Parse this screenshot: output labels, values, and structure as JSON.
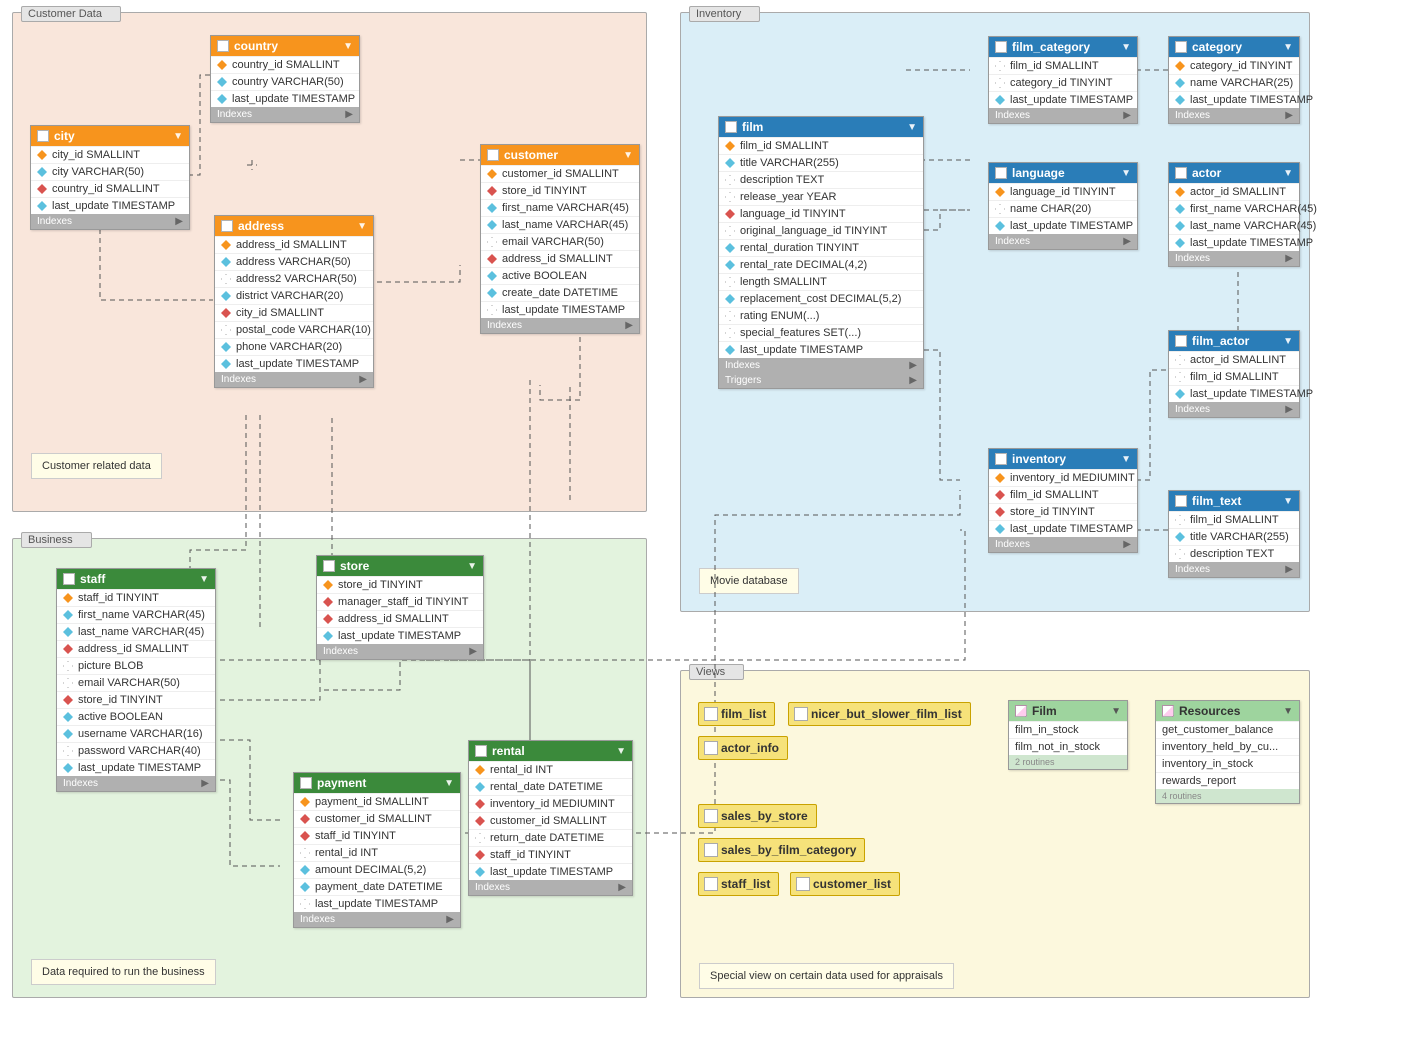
{
  "regions": {
    "customer": {
      "label": "Customer Data",
      "note": "Customer related data"
    },
    "business": {
      "label": "Business",
      "note": "Data required to run the business"
    },
    "inventory": {
      "label": "Inventory",
      "note": "Movie database"
    },
    "views": {
      "label": "Views",
      "note": "Special view on certain data used for appraisals"
    }
  },
  "footers": {
    "indexes": "Indexes",
    "triggers": "Triggers"
  },
  "routines_footer": {
    "film": "2 routines",
    "resources": "4 routines"
  },
  "tables": {
    "country": {
      "name": "country",
      "cols": [
        {
          "t": "pk",
          "n": "country_id SMALLINT"
        },
        {
          "t": "idx",
          "n": "country VARCHAR(50)"
        },
        {
          "t": "idx",
          "n": "last_update TIMESTAMP"
        }
      ]
    },
    "city": {
      "name": "city",
      "cols": [
        {
          "t": "pk",
          "n": "city_id SMALLINT"
        },
        {
          "t": "idx",
          "n": "city VARCHAR(50)"
        },
        {
          "t": "fk",
          "n": "country_id SMALLINT"
        },
        {
          "t": "idx",
          "n": "last_update TIMESTAMP"
        }
      ]
    },
    "address": {
      "name": "address",
      "cols": [
        {
          "t": "pk",
          "n": "address_id SMALLINT"
        },
        {
          "t": "idx",
          "n": "address VARCHAR(50)"
        },
        {
          "t": "att",
          "n": "address2 VARCHAR(50)"
        },
        {
          "t": "idx",
          "n": "district VARCHAR(20)"
        },
        {
          "t": "fk",
          "n": "city_id SMALLINT"
        },
        {
          "t": "att",
          "n": "postal_code VARCHAR(10)"
        },
        {
          "t": "idx",
          "n": "phone VARCHAR(20)"
        },
        {
          "t": "idx",
          "n": "last_update TIMESTAMP"
        }
      ]
    },
    "customer": {
      "name": "customer",
      "cols": [
        {
          "t": "pk",
          "n": "customer_id SMALLINT"
        },
        {
          "t": "fk",
          "n": "store_id TINYINT"
        },
        {
          "t": "idx",
          "n": "first_name VARCHAR(45)"
        },
        {
          "t": "idx",
          "n": "last_name VARCHAR(45)"
        },
        {
          "t": "att",
          "n": "email VARCHAR(50)"
        },
        {
          "t": "fk",
          "n": "address_id SMALLINT"
        },
        {
          "t": "idx",
          "n": "active BOOLEAN"
        },
        {
          "t": "idx",
          "n": "create_date DATETIME"
        },
        {
          "t": "att",
          "n": "last_update TIMESTAMP"
        }
      ]
    },
    "staff": {
      "name": "staff",
      "cols": [
        {
          "t": "pk",
          "n": "staff_id TINYINT"
        },
        {
          "t": "idx",
          "n": "first_name VARCHAR(45)"
        },
        {
          "t": "idx",
          "n": "last_name VARCHAR(45)"
        },
        {
          "t": "fk",
          "n": "address_id SMALLINT"
        },
        {
          "t": "att",
          "n": "picture BLOB"
        },
        {
          "t": "att",
          "n": "email VARCHAR(50)"
        },
        {
          "t": "fk",
          "n": "store_id TINYINT"
        },
        {
          "t": "idx",
          "n": "active BOOLEAN"
        },
        {
          "t": "idx",
          "n": "username VARCHAR(16)"
        },
        {
          "t": "att",
          "n": "password VARCHAR(40)"
        },
        {
          "t": "idx",
          "n": "last_update TIMESTAMP"
        }
      ]
    },
    "store": {
      "name": "store",
      "cols": [
        {
          "t": "pk",
          "n": "store_id TINYINT"
        },
        {
          "t": "fk",
          "n": "manager_staff_id TINYINT"
        },
        {
          "t": "fk",
          "n": "address_id SMALLINT"
        },
        {
          "t": "idx",
          "n": "last_update TIMESTAMP"
        }
      ]
    },
    "payment": {
      "name": "payment",
      "cols": [
        {
          "t": "pk",
          "n": "payment_id SMALLINT"
        },
        {
          "t": "fk",
          "n": "customer_id SMALLINT"
        },
        {
          "t": "fk",
          "n": "staff_id TINYINT"
        },
        {
          "t": "att",
          "n": "rental_id INT"
        },
        {
          "t": "idx",
          "n": "amount DECIMAL(5,2)"
        },
        {
          "t": "idx",
          "n": "payment_date DATETIME"
        },
        {
          "t": "att",
          "n": "last_update TIMESTAMP"
        }
      ]
    },
    "rental": {
      "name": "rental",
      "cols": [
        {
          "t": "pk",
          "n": "rental_id INT"
        },
        {
          "t": "idx",
          "n": "rental_date DATETIME"
        },
        {
          "t": "fk",
          "n": "inventory_id MEDIUMINT"
        },
        {
          "t": "fk",
          "n": "customer_id SMALLINT"
        },
        {
          "t": "att",
          "n": "return_date DATETIME"
        },
        {
          "t": "fk",
          "n": "staff_id TINYINT"
        },
        {
          "t": "idx",
          "n": "last_update TIMESTAMP"
        }
      ]
    },
    "film": {
      "name": "film",
      "cols": [
        {
          "t": "pk",
          "n": "film_id SMALLINT"
        },
        {
          "t": "idx",
          "n": "title VARCHAR(255)"
        },
        {
          "t": "att",
          "n": "description TEXT"
        },
        {
          "t": "att",
          "n": "release_year YEAR"
        },
        {
          "t": "fk",
          "n": "language_id TINYINT"
        },
        {
          "t": "att",
          "n": "original_language_id TINYINT"
        },
        {
          "t": "idx",
          "n": "rental_duration TINYINT"
        },
        {
          "t": "idx",
          "n": "rental_rate DECIMAL(4,2)"
        },
        {
          "t": "att",
          "n": "length SMALLINT"
        },
        {
          "t": "idx",
          "n": "replacement_cost DECIMAL(5,2)"
        },
        {
          "t": "att",
          "n": "rating ENUM(...)"
        },
        {
          "t": "att",
          "n": "special_features SET(...)"
        },
        {
          "t": "idx",
          "n": "last_update TIMESTAMP"
        }
      ]
    },
    "film_category": {
      "name": "film_category",
      "cols": [
        {
          "t": "att",
          "n": "film_id SMALLINT"
        },
        {
          "t": "att",
          "n": "category_id TINYINT"
        },
        {
          "t": "idx",
          "n": "last_update TIMESTAMP"
        }
      ]
    },
    "category": {
      "name": "category",
      "cols": [
        {
          "t": "pk",
          "n": "category_id TINYINT"
        },
        {
          "t": "idx",
          "n": "name VARCHAR(25)"
        },
        {
          "t": "idx",
          "n": "last_update TIMESTAMP"
        }
      ]
    },
    "language": {
      "name": "language",
      "cols": [
        {
          "t": "pk",
          "n": "language_id TINYINT"
        },
        {
          "t": "att",
          "n": "name CHAR(20)"
        },
        {
          "t": "idx",
          "n": "last_update TIMESTAMP"
        }
      ]
    },
    "actor": {
      "name": "actor",
      "cols": [
        {
          "t": "pk",
          "n": "actor_id SMALLINT"
        },
        {
          "t": "idx",
          "n": "first_name VARCHAR(45)"
        },
        {
          "t": "idx",
          "n": "last_name VARCHAR(45)"
        },
        {
          "t": "idx",
          "n": "last_update TIMESTAMP"
        }
      ]
    },
    "film_actor": {
      "name": "film_actor",
      "cols": [
        {
          "t": "att",
          "n": "actor_id SMALLINT"
        },
        {
          "t": "att",
          "n": "film_id SMALLINT"
        },
        {
          "t": "idx",
          "n": "last_update TIMESTAMP"
        }
      ]
    },
    "inventory": {
      "name": "inventory",
      "cols": [
        {
          "t": "pk",
          "n": "inventory_id MEDIUMINT"
        },
        {
          "t": "fk",
          "n": "film_id SMALLINT"
        },
        {
          "t": "fk",
          "n": "store_id TINYINT"
        },
        {
          "t": "idx",
          "n": "last_update TIMESTAMP"
        }
      ]
    },
    "film_text": {
      "name": "film_text",
      "cols": [
        {
          "t": "att",
          "n": "film_id SMALLINT"
        },
        {
          "t": "idx",
          "n": "title VARCHAR(255)"
        },
        {
          "t": "att",
          "n": "description TEXT"
        }
      ]
    },
    "film_routines": {
      "name": "Film",
      "cols": [
        {
          "t": "att",
          "n": "film_in_stock"
        },
        {
          "t": "att",
          "n": "film_not_in_stock"
        }
      ]
    },
    "resources_routines": {
      "name": "Resources",
      "cols": [
        {
          "t": "att",
          "n": "get_customer_balance"
        },
        {
          "t": "att",
          "n": "inventory_held_by_cu..."
        },
        {
          "t": "att",
          "n": "inventory_in_stock"
        },
        {
          "t": "att",
          "n": "rewards_report"
        }
      ]
    }
  },
  "views": {
    "film_list": "film_list",
    "nicer": "nicer_but_slower_film_list",
    "actor_info": "actor_info",
    "sales_store": "sales_by_store",
    "sales_cat": "sales_by_film_category",
    "staff_list": "staff_list",
    "customer_list": "customer_list"
  }
}
